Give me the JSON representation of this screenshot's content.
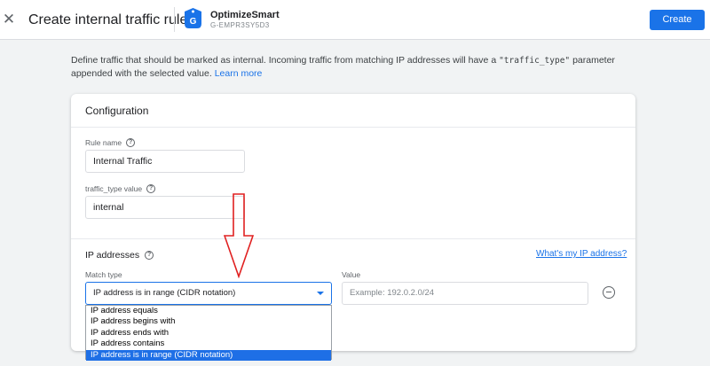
{
  "header": {
    "close_icon": "close-icon",
    "title": "Create internal traffic rule",
    "property": {
      "icon": "tag-icon",
      "icon_letter": "G",
      "name": "OptimizeSmart",
      "id": "G-EMPR3SY5D3"
    },
    "create_label": "Create"
  },
  "description": {
    "text_before": "Define traffic that should be marked as internal. Incoming traffic from matching IP addresses will have a ",
    "code": "\"traffic_type\"",
    "text_after": " parameter appended with the selected value. ",
    "link": "Learn more"
  },
  "config": {
    "title": "Configuration",
    "rule_name": {
      "label": "Rule name",
      "value": "Internal Traffic"
    },
    "traffic_type": {
      "label": "traffic_type value",
      "value": "internal"
    }
  },
  "ip": {
    "heading": "IP addresses",
    "link": "What's my IP address?",
    "match_type_label": "Match type",
    "match_type_value": "IP address is in range (CIDR notation)",
    "value_label": "Value",
    "value_placeholder": "Example: 192.0.2.0/24",
    "options": [
      "IP address equals",
      "IP address begins with",
      "IP address ends with",
      "IP address contains",
      "IP address is in range (CIDR notation)"
    ],
    "selected_index": 4
  },
  "colors": {
    "accent": "#1a73e8",
    "annotation_arrow": "#e02020",
    "selected_option_bg": "#1e6fe6"
  }
}
